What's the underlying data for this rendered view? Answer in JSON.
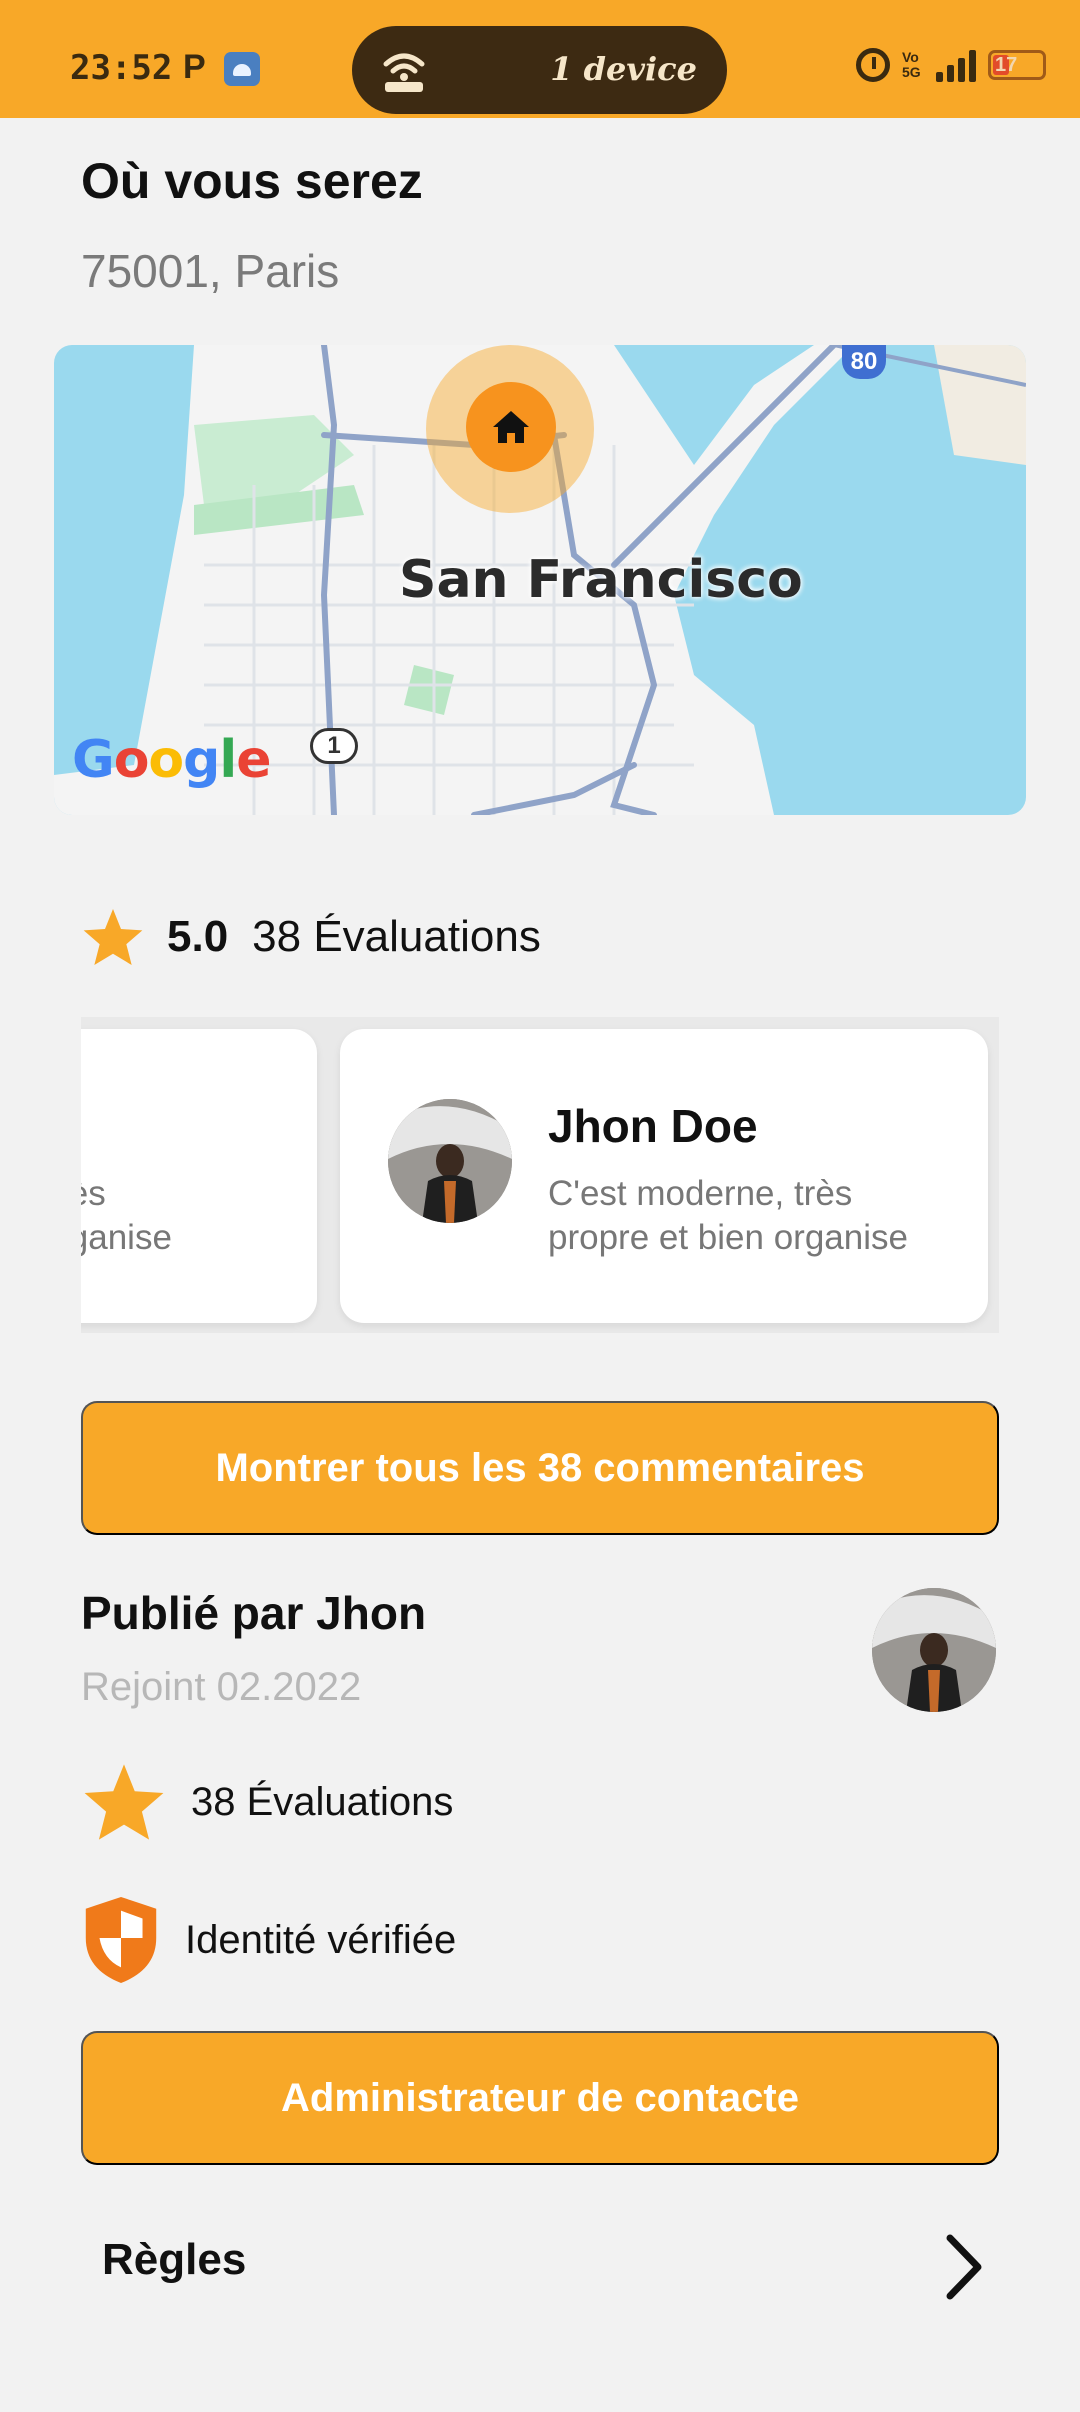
{
  "status_bar": {
    "time": "23:52",
    "notif_letter": "P",
    "pill_text": "1 device",
    "volte": "Vo 5G",
    "network": "5G",
    "battery": "17"
  },
  "location": {
    "title": "Où vous serez",
    "address": "75001, Paris"
  },
  "map": {
    "city": "San Francisco",
    "highway_1": "1",
    "highway_80": "80",
    "google": [
      "G",
      "o",
      "o",
      "g",
      "l",
      "e"
    ]
  },
  "rating": {
    "score": "5.0",
    "count": "38 Évaluations"
  },
  "reviews": [
    {
      "name": "",
      "text_line1": "ne, très",
      "text_line2": "en organise"
    },
    {
      "name": "Jhon Doe",
      "text_line1": "C'est moderne, très",
      "text_line2": "propre et bien organise"
    }
  ],
  "buttons": {
    "show_comments": "Montrer tous les 38 commentaires",
    "contact_admin": "Administrateur de contacte"
  },
  "publisher": {
    "title": "Publié par Jhon",
    "joined": "Rejoint 02.2022",
    "reviews": "38 Évaluations",
    "verified": "Identité vérifiée"
  },
  "rules": {
    "label": "Règles"
  },
  "colors": {
    "accent": "#f8a828",
    "status_pill": "#3d2a12",
    "shield": "#f07a1a"
  }
}
